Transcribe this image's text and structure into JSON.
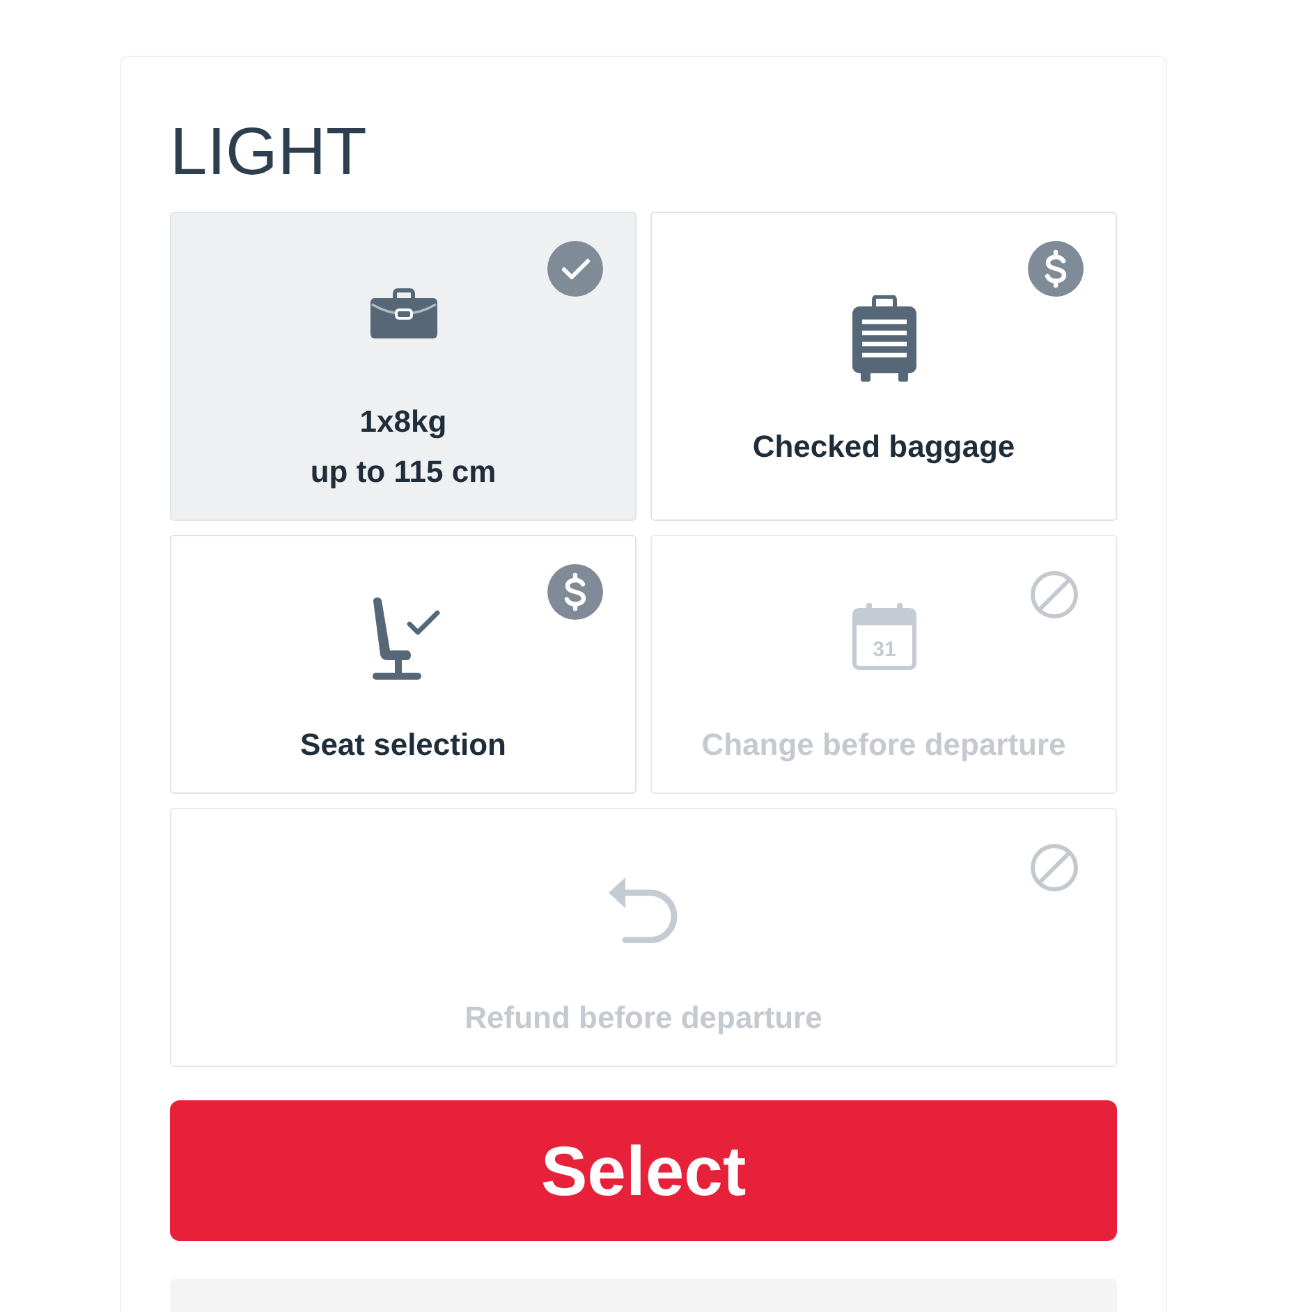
{
  "plan": {
    "title": "LIGHT"
  },
  "features": [
    {
      "kind": "included",
      "label": "1x8kg\nup to 115 cm"
    },
    {
      "kind": "paid",
      "label": "Checked baggage"
    },
    {
      "kind": "paid",
      "label": "Seat selection"
    },
    {
      "kind": "unavailable",
      "label": "Change before departure",
      "icon_text": "31"
    },
    {
      "kind": "unavailable",
      "label": "Refund before departure"
    }
  ],
  "select_button": {
    "label": "Select"
  }
}
